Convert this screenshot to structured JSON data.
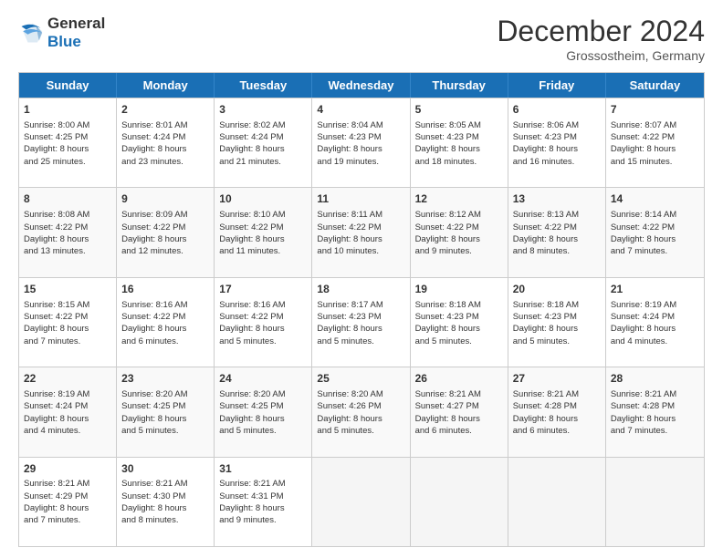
{
  "logo": {
    "line1": "General",
    "line2": "Blue"
  },
  "header": {
    "month": "December 2024",
    "location": "Grossostheim, Germany"
  },
  "weekdays": [
    "Sunday",
    "Monday",
    "Tuesday",
    "Wednesday",
    "Thursday",
    "Friday",
    "Saturday"
  ],
  "rows": [
    [
      {
        "day": "1",
        "lines": [
          "Sunrise: 8:00 AM",
          "Sunset: 4:25 PM",
          "Daylight: 8 hours",
          "and 25 minutes."
        ]
      },
      {
        "day": "2",
        "lines": [
          "Sunrise: 8:01 AM",
          "Sunset: 4:24 PM",
          "Daylight: 8 hours",
          "and 23 minutes."
        ]
      },
      {
        "day": "3",
        "lines": [
          "Sunrise: 8:02 AM",
          "Sunset: 4:24 PM",
          "Daylight: 8 hours",
          "and 21 minutes."
        ]
      },
      {
        "day": "4",
        "lines": [
          "Sunrise: 8:04 AM",
          "Sunset: 4:23 PM",
          "Daylight: 8 hours",
          "and 19 minutes."
        ]
      },
      {
        "day": "5",
        "lines": [
          "Sunrise: 8:05 AM",
          "Sunset: 4:23 PM",
          "Daylight: 8 hours",
          "and 18 minutes."
        ]
      },
      {
        "day": "6",
        "lines": [
          "Sunrise: 8:06 AM",
          "Sunset: 4:23 PM",
          "Daylight: 8 hours",
          "and 16 minutes."
        ]
      },
      {
        "day": "7",
        "lines": [
          "Sunrise: 8:07 AM",
          "Sunset: 4:22 PM",
          "Daylight: 8 hours",
          "and 15 minutes."
        ]
      }
    ],
    [
      {
        "day": "8",
        "lines": [
          "Sunrise: 8:08 AM",
          "Sunset: 4:22 PM",
          "Daylight: 8 hours",
          "and 13 minutes."
        ]
      },
      {
        "day": "9",
        "lines": [
          "Sunrise: 8:09 AM",
          "Sunset: 4:22 PM",
          "Daylight: 8 hours",
          "and 12 minutes."
        ]
      },
      {
        "day": "10",
        "lines": [
          "Sunrise: 8:10 AM",
          "Sunset: 4:22 PM",
          "Daylight: 8 hours",
          "and 11 minutes."
        ]
      },
      {
        "day": "11",
        "lines": [
          "Sunrise: 8:11 AM",
          "Sunset: 4:22 PM",
          "Daylight: 8 hours",
          "and 10 minutes."
        ]
      },
      {
        "day": "12",
        "lines": [
          "Sunrise: 8:12 AM",
          "Sunset: 4:22 PM",
          "Daylight: 8 hours",
          "and 9 minutes."
        ]
      },
      {
        "day": "13",
        "lines": [
          "Sunrise: 8:13 AM",
          "Sunset: 4:22 PM",
          "Daylight: 8 hours",
          "and 8 minutes."
        ]
      },
      {
        "day": "14",
        "lines": [
          "Sunrise: 8:14 AM",
          "Sunset: 4:22 PM",
          "Daylight: 8 hours",
          "and 7 minutes."
        ]
      }
    ],
    [
      {
        "day": "15",
        "lines": [
          "Sunrise: 8:15 AM",
          "Sunset: 4:22 PM",
          "Daylight: 8 hours",
          "and 7 minutes."
        ]
      },
      {
        "day": "16",
        "lines": [
          "Sunrise: 8:16 AM",
          "Sunset: 4:22 PM",
          "Daylight: 8 hours",
          "and 6 minutes."
        ]
      },
      {
        "day": "17",
        "lines": [
          "Sunrise: 8:16 AM",
          "Sunset: 4:22 PM",
          "Daylight: 8 hours",
          "and 5 minutes."
        ]
      },
      {
        "day": "18",
        "lines": [
          "Sunrise: 8:17 AM",
          "Sunset: 4:23 PM",
          "Daylight: 8 hours",
          "and 5 minutes."
        ]
      },
      {
        "day": "19",
        "lines": [
          "Sunrise: 8:18 AM",
          "Sunset: 4:23 PM",
          "Daylight: 8 hours",
          "and 5 minutes."
        ]
      },
      {
        "day": "20",
        "lines": [
          "Sunrise: 8:18 AM",
          "Sunset: 4:23 PM",
          "Daylight: 8 hours",
          "and 5 minutes."
        ]
      },
      {
        "day": "21",
        "lines": [
          "Sunrise: 8:19 AM",
          "Sunset: 4:24 PM",
          "Daylight: 8 hours",
          "and 4 minutes."
        ]
      }
    ],
    [
      {
        "day": "22",
        "lines": [
          "Sunrise: 8:19 AM",
          "Sunset: 4:24 PM",
          "Daylight: 8 hours",
          "and 4 minutes."
        ]
      },
      {
        "day": "23",
        "lines": [
          "Sunrise: 8:20 AM",
          "Sunset: 4:25 PM",
          "Daylight: 8 hours",
          "and 5 minutes."
        ]
      },
      {
        "day": "24",
        "lines": [
          "Sunrise: 8:20 AM",
          "Sunset: 4:25 PM",
          "Daylight: 8 hours",
          "and 5 minutes."
        ]
      },
      {
        "day": "25",
        "lines": [
          "Sunrise: 8:20 AM",
          "Sunset: 4:26 PM",
          "Daylight: 8 hours",
          "and 5 minutes."
        ]
      },
      {
        "day": "26",
        "lines": [
          "Sunrise: 8:21 AM",
          "Sunset: 4:27 PM",
          "Daylight: 8 hours",
          "and 6 minutes."
        ]
      },
      {
        "day": "27",
        "lines": [
          "Sunrise: 8:21 AM",
          "Sunset: 4:28 PM",
          "Daylight: 8 hours",
          "and 6 minutes."
        ]
      },
      {
        "day": "28",
        "lines": [
          "Sunrise: 8:21 AM",
          "Sunset: 4:28 PM",
          "Daylight: 8 hours",
          "and 7 minutes."
        ]
      }
    ],
    [
      {
        "day": "29",
        "lines": [
          "Sunrise: 8:21 AM",
          "Sunset: 4:29 PM",
          "Daylight: 8 hours",
          "and 7 minutes."
        ]
      },
      {
        "day": "30",
        "lines": [
          "Sunrise: 8:21 AM",
          "Sunset: 4:30 PM",
          "Daylight: 8 hours",
          "and 8 minutes."
        ]
      },
      {
        "day": "31",
        "lines": [
          "Sunrise: 8:21 AM",
          "Sunset: 4:31 PM",
          "Daylight: 8 hours",
          "and 9 minutes."
        ]
      },
      null,
      null,
      null,
      null
    ]
  ]
}
